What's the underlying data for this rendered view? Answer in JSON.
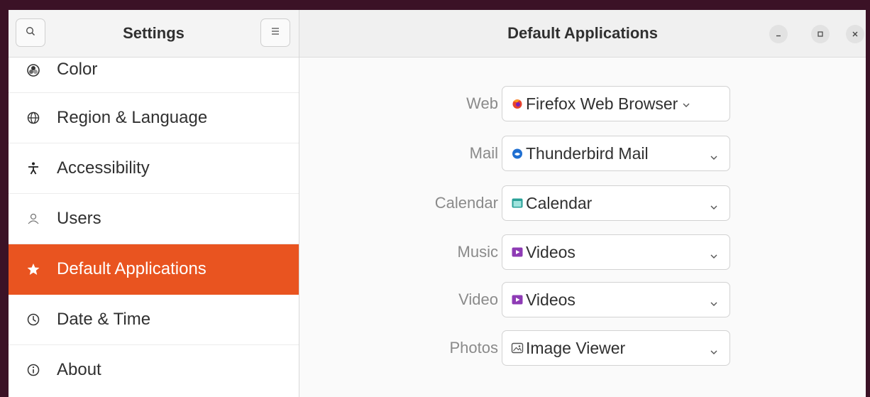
{
  "sidebar": {
    "title": "Settings",
    "search_icon": "search-icon",
    "menu_icon": "hamburger-menu-icon",
    "items": [
      {
        "label": "Color",
        "icon": "color-icon"
      },
      {
        "label": "Region & Language",
        "icon": "globe-icon"
      },
      {
        "label": "Accessibility",
        "icon": "accessibility-icon"
      },
      {
        "label": "Users",
        "icon": "users-icon"
      },
      {
        "label": "Default Applications",
        "icon": "star-icon",
        "active": true
      },
      {
        "label": "Date & Time",
        "icon": "clock-icon"
      },
      {
        "label": "About",
        "icon": "info-icon"
      }
    ]
  },
  "main": {
    "title": "Default Applications",
    "rows": [
      {
        "label": "Web",
        "value": "Firefox Web Browser",
        "icon": "firefox-icon"
      },
      {
        "label": "Mail",
        "value": "Thunderbird Mail",
        "icon": "thunderbird-icon"
      },
      {
        "label": "Calendar",
        "value": "Calendar",
        "icon": "calendar-icon"
      },
      {
        "label": "Music",
        "value": "Videos",
        "icon": "videos-icon"
      },
      {
        "label": "Video",
        "value": "Videos",
        "icon": "videos-icon"
      },
      {
        "label": "Photos",
        "value": "Image Viewer",
        "icon": "image-viewer-icon"
      }
    ]
  },
  "window_controls": [
    "minimize-icon",
    "maximize-icon",
    "close-icon"
  ],
  "colors": {
    "accent": "#e95420",
    "window_frame": "#3b1226"
  }
}
